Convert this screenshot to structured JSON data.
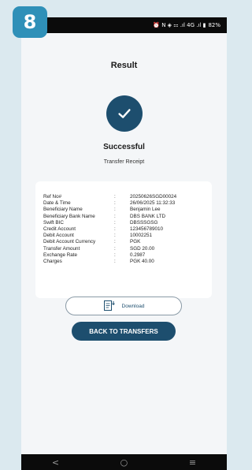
{
  "step_badge": "8",
  "status_bar": {
    "icons": [
      "alarm-icon",
      "nfc-icon",
      "vibrate-icon",
      "data-icon",
      "signal-icon",
      "network-4g-icon",
      "signal-icon",
      "battery-icon"
    ],
    "text": "⏰ N ◈ ⚏ .ıl 4G .ıl ▮",
    "battery": "82%"
  },
  "page": {
    "title": "Result",
    "status_icon": "check-icon",
    "status_title": "Successful",
    "subtitle": "Transfer Receipt"
  },
  "colors": {
    "primary": "#1d4e6e",
    "badge": "#2f90b8",
    "background": "#dbe9ef"
  },
  "details": [
    {
      "label": "Ref No#",
      "sep": ":",
      "value": "20250626SGD00024"
    },
    {
      "label": "Date & Time",
      "sep": ":",
      "value": "26/06/2025 11:32:33"
    },
    {
      "label": "Beneficiary Name",
      "sep": ":",
      "value": "Benjamin Lee"
    },
    {
      "label": "Beneficiary Bank Name",
      "sep": ":",
      "value": "DBS BANK LTD"
    },
    {
      "label": "Swift BIC",
      "sep": ":",
      "value": "DBSSSGSG"
    },
    {
      "label": "Credit Account",
      "sep": ":",
      "value": "123456789010"
    },
    {
      "label": "Debit Account",
      "sep": ":",
      "value": "10002251"
    },
    {
      "label": "Debit Account Currency",
      "sep": ":",
      "value": "PGK"
    },
    {
      "label": "Transfer Amount",
      "sep": ":",
      "value": "SGD 20.00"
    },
    {
      "label": "Exchange Rate",
      "sep": ":",
      "value": "0.2987"
    },
    {
      "label": "Charges",
      "sep": ":",
      "value": "PGK 40.00"
    }
  ],
  "actions": {
    "download_label": "Download",
    "download_icon": "receipt-download-icon",
    "back_label": "BACK TO TRANSFERS"
  },
  "nav": {
    "back_glyph": "<",
    "home_glyph": "○",
    "menu_glyph": "≡"
  }
}
